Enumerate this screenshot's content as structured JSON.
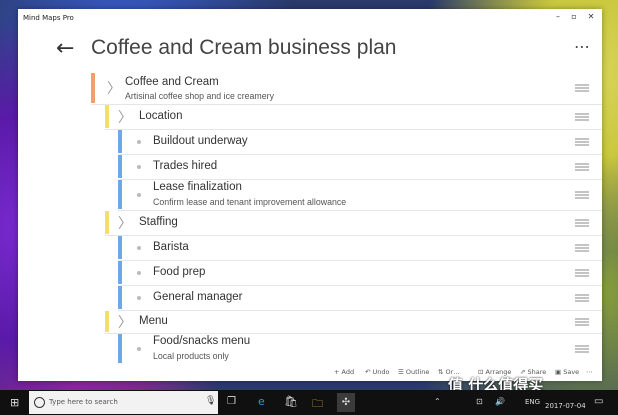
{
  "window": {
    "app_title": "Mind Maps Pro",
    "minimize": "–",
    "maximize": "▫",
    "close": "✕"
  },
  "header": {
    "back_icon": "arrow-left",
    "title": "Coffee and Cream business plan",
    "more_icon": "⋯"
  },
  "colors": {
    "root": "#f0a070",
    "level1": "#f7de6a",
    "level2": "#6fa8e8"
  },
  "nodes": [
    {
      "label": "Coffee and Cream",
      "sub": "Artisinal coffee shop and ice creamery",
      "level": 0
    },
    {
      "label": "Location",
      "sub": "",
      "level": 1
    },
    {
      "label": "Buildout underway",
      "sub": "",
      "level": 2
    },
    {
      "label": "Trades hired",
      "sub": "",
      "level": 2
    },
    {
      "label": "Lease finalization",
      "sub": "Confirm lease and tenant improvement allowance",
      "level": 2
    },
    {
      "label": "Staffing",
      "sub": "",
      "level": 1
    },
    {
      "label": "Barista",
      "sub": "",
      "level": 2
    },
    {
      "label": "Food prep",
      "sub": "",
      "level": 2
    },
    {
      "label": "General manager",
      "sub": "",
      "level": 2
    },
    {
      "label": "Menu",
      "sub": "",
      "level": 1
    },
    {
      "label": "Food/snacks menu",
      "sub": "Local products only",
      "level": 2
    }
  ],
  "commands": {
    "add": "Add",
    "undo": "Undo",
    "outline": "Outline",
    "order": "Or…",
    "arrange": "Arrange",
    "share": "Share",
    "save": "Save",
    "more": "⋯"
  },
  "taskbar": {
    "search_placeholder": "Type here to search",
    "lang": "ENG",
    "date": "2017-07-04"
  },
  "watermark": "值 什么值得买"
}
